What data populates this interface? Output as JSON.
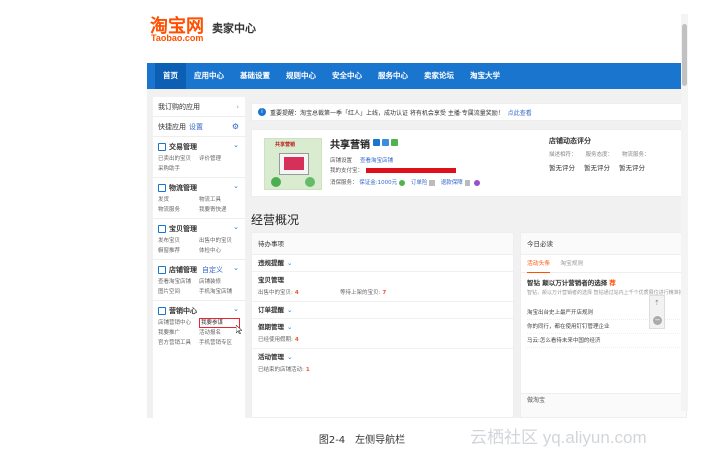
{
  "header": {
    "logo_cn": "淘宝网",
    "logo_en": "Taobao.com",
    "subtitle": "卖家中心"
  },
  "nav": [
    "首页",
    "应用中心",
    "基础设置",
    "规则中心",
    "安全中心",
    "服务中心",
    "卖家论坛",
    "淘宝大学"
  ],
  "sidebar": {
    "my_apps": "我订购的应用",
    "quick": "快捷应用",
    "quick_link": "设置",
    "groups": [
      {
        "title": "交易管理",
        "extra": "",
        "links": [
          "已卖出的宝贝",
          "评价管理",
          "采购助手"
        ]
      },
      {
        "title": "物流管理",
        "extra": "",
        "links": [
          "发货",
          "物流工具",
          "物流服务",
          "我要寄快递"
        ]
      },
      {
        "title": "宝贝管理",
        "extra": "",
        "links": [
          "发布宝贝",
          "出售中的宝贝",
          "橱窗推荐",
          "体检中心"
        ]
      },
      {
        "title": "店铺管理",
        "extra": "自定义",
        "links": [
          "查看淘宝店铺",
          "店铺装修",
          "图片空间",
          "手机淘宝店铺"
        ]
      },
      {
        "title": "营销中心",
        "extra": "",
        "links": [
          "店铺营销中心",
          "我要参谋",
          "我要推广",
          "活动报名",
          "官方营销工具",
          "手机营销专区"
        ]
      }
    ]
  },
  "notice": {
    "text": "重要提醒：淘宝总裁第一季「红人」上线，成功认证 将有机会享受 主播·专属流量奖励！",
    "link": "点此查看"
  },
  "shop": {
    "name": "共享营销",
    "sign": "共享营销",
    "line1_label": "店铺设置",
    "line1_link": "查看淘宝店铺",
    "line2_label": "我的支付宝：",
    "line3_label": "消保服务：",
    "deposit": "保证金:1000元",
    "order_link": "订单险",
    "claim_link": "退款保障"
  },
  "rating": {
    "title": "店铺动态评分",
    "labels": [
      "描述相符：",
      "服务态度：",
      "物流服务："
    ],
    "values": [
      "暂无评分",
      "暂无评分",
      "暂无评分"
    ]
  },
  "overview": {
    "title": "经营概况"
  },
  "todo": {
    "head": "待办事项",
    "sections": [
      {
        "title": "违规提醒",
        "chev": true,
        "rows": []
      },
      {
        "title": "宝贝管理",
        "chev": false,
        "rows": [
          [
            {
              "label": "出售中的宝贝:",
              "num": "4"
            },
            {
              "label": "等待上架的宝贝:",
              "num": "7"
            }
          ]
        ]
      },
      {
        "title": "订单提醒",
        "chev": true,
        "rows": []
      },
      {
        "title": "假期管理",
        "chev": true,
        "rows": [
          [
            {
              "label": "已经使用假期:",
              "num": "4"
            }
          ]
        ]
      },
      {
        "title": "活动管理",
        "chev": true,
        "rows": [
          [
            {
              "label": "已结束的店铺活动:",
              "num": "1"
            }
          ]
        ]
      }
    ]
  },
  "today": {
    "head": "今日必读",
    "tabs": [
      "活动头条",
      "淘宝规则"
    ],
    "item_title": "智钻 颠以万计营销者的选择",
    "item_hot": "荐",
    "item_sub": "智钻，颠以万计营销者的选择 智钻通过站内上千个优质展位进行精准投放是目前电商推广平台",
    "news": [
      "淘宝出台史上最严开店规则",
      "你的同行，都在使用钉钉管理企业",
      "马云:怎么看待未来中国的经济"
    ],
    "tmall": "做淘宝"
  },
  "caption": "图2-4　左侧导航栏",
  "watermark": "云栖社区 yq.aliyun.com",
  "colors": {
    "accent": "#1a75ce",
    "brand": "#ff5000",
    "highlight": "#e22233"
  }
}
